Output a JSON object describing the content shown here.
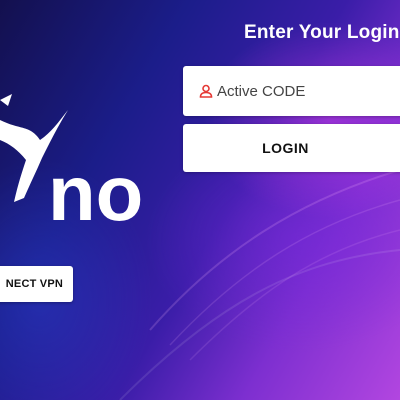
{
  "login": {
    "title": "Enter Your Login I",
    "code_placeholder": "Active CODE",
    "login_label": "LOGIN"
  },
  "logo": {
    "text": "no"
  },
  "vpn": {
    "label": "NECT VPN"
  },
  "icons": {
    "code_field_icon": "user-icon",
    "logo_figure": "runner-figure-icon"
  },
  "colors": {
    "background_deep": "#13104e",
    "background_mid": "#3a1da8",
    "background_light": "#b246e0",
    "accent_icon": "#e53935",
    "button_bg": "#ffffff",
    "button_text": "#111111"
  }
}
